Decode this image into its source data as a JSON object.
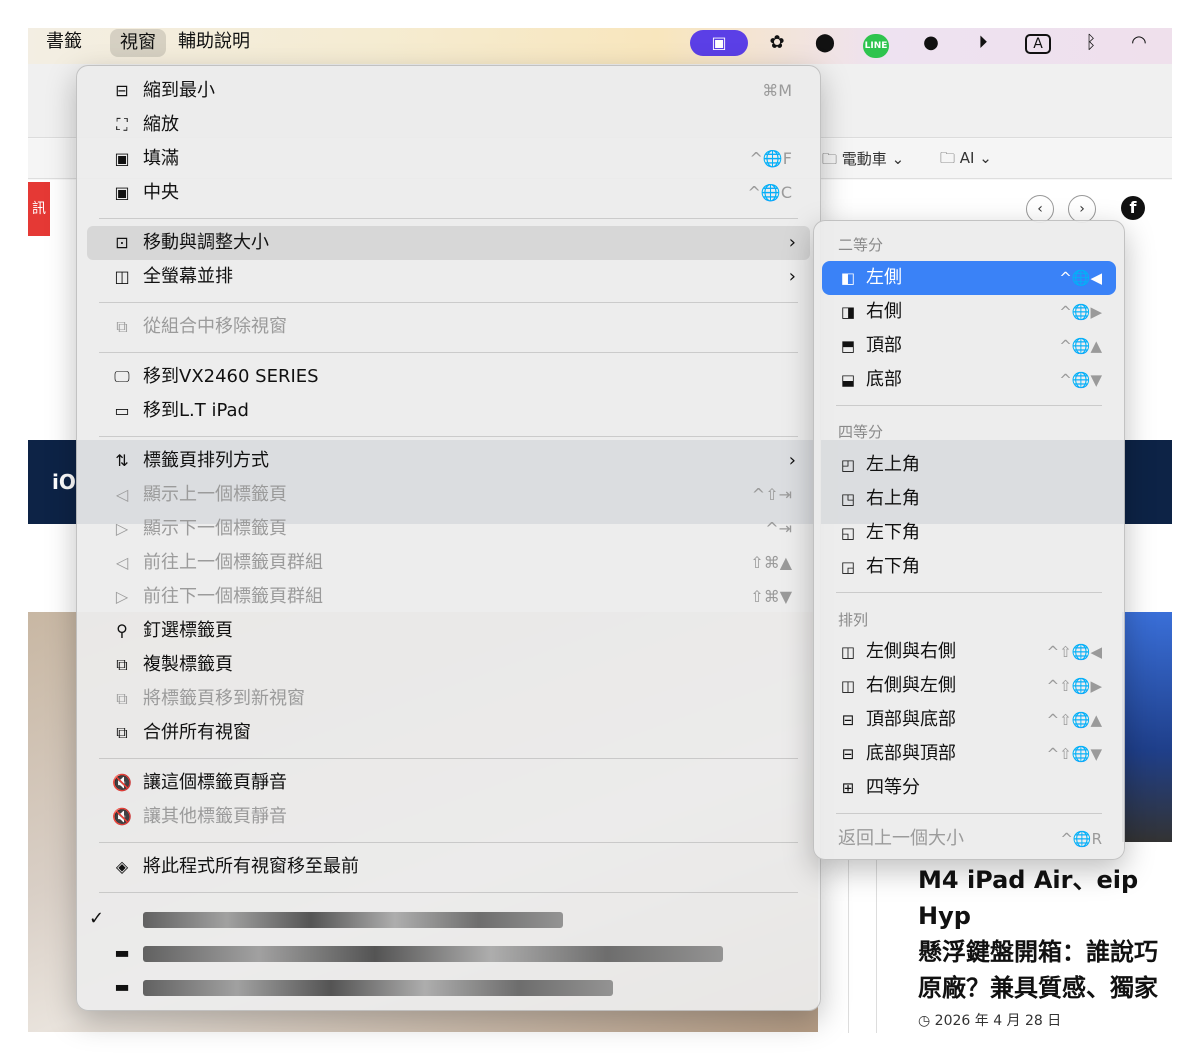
{
  "menubar": {
    "items": [
      "書籤",
      "視窗",
      "輔助說明"
    ],
    "icons": [
      "screen-share-icon",
      "chatgpt-icon",
      "ball-icon",
      "line-app-icon",
      "wechat-icon",
      "play-icon",
      "input-method-icon",
      "bluetooth-icon",
      "wifi-icon"
    ],
    "line_text": "LINE",
    "input_text": "A"
  },
  "browser": {
    "favorites": [
      "電動車",
      "AI"
    ],
    "site_badge": "訊",
    "nav_prev": "‹",
    "nav_next": "›",
    "nav_logo": "iO",
    "article": {
      "title": "M4 iPad Air、eip Hyp\n懸浮鍵盤開箱：誰說巧\n原廠？兼具質感、獨家\n能更好用",
      "date": "2026 年 4 月 28 日"
    }
  },
  "main_menu": {
    "items": [
      {
        "label": "縮到最小",
        "shortcut": "⌘M",
        "icon": "minimize-icon",
        "enabled": true
      },
      {
        "label": "縮放",
        "shortcut": "",
        "icon": "zoom-icon",
        "enabled": true
      },
      {
        "label": "填滿",
        "shortcut": "^🌐F",
        "icon": "fill-icon",
        "enabled": true
      },
      {
        "label": "中央",
        "shortcut": "^🌐C",
        "icon": "center-icon",
        "enabled": true
      },
      {
        "label": "移動與調整大小",
        "shortcut": "",
        "icon": "move-resize-icon",
        "enabled": true,
        "submenu": true,
        "highlighted": true
      },
      {
        "label": "全螢幕並排",
        "shortcut": "",
        "icon": "full-screen-tile-icon",
        "enabled": true,
        "submenu": true
      },
      {
        "label": "從組合中移除視窗",
        "shortcut": "",
        "icon": "remove-window-icon",
        "enabled": false
      },
      {
        "label": "移到VX2460 SERIES",
        "shortcut": "",
        "icon": "display-icon",
        "enabled": true
      },
      {
        "label": "移到L.T iPad",
        "shortcut": "",
        "icon": "ipad-icon",
        "enabled": true
      },
      {
        "label": "標籤頁排列方式",
        "shortcut": "",
        "icon": "sort-icon",
        "enabled": true,
        "submenu": true
      },
      {
        "label": "顯示上一個標籤頁",
        "shortcut": "^⇧⇥",
        "icon": "prev-tab-icon",
        "enabled": false
      },
      {
        "label": "顯示下一個標籤頁",
        "shortcut": "^⇥",
        "icon": "next-tab-icon",
        "enabled": false
      },
      {
        "label": "前往上一個標籤頁群組",
        "shortcut": "⇧⌘▲",
        "icon": "prev-group-icon",
        "enabled": false
      },
      {
        "label": "前往下一個標籤頁群組",
        "shortcut": "⇧⌘▼",
        "icon": "next-group-icon",
        "enabled": false
      },
      {
        "label": "釘選標籤頁",
        "shortcut": "",
        "icon": "pin-icon",
        "enabled": true
      },
      {
        "label": "複製標籤頁",
        "shortcut": "",
        "icon": "duplicate-icon",
        "enabled": true
      },
      {
        "label": "將標籤頁移到新視窗",
        "shortcut": "",
        "icon": "move-tab-icon",
        "enabled": false
      },
      {
        "label": "合併所有視窗",
        "shortcut": "",
        "icon": "merge-windows-icon",
        "enabled": true
      },
      {
        "label": "讓這個標籤頁靜音",
        "shortcut": "",
        "icon": "mute-icon",
        "enabled": true
      },
      {
        "label": "讓其他標籤頁靜音",
        "shortcut": "",
        "icon": "mute-others-icon",
        "enabled": false
      },
      {
        "label": "將此程式所有視窗移至最前",
        "shortcut": "",
        "icon": "bring-front-icon",
        "enabled": true
      }
    ],
    "check_mark": "✓"
  },
  "submenu": {
    "sections": [
      {
        "header": "二等分",
        "items": [
          {
            "label": "左側",
            "shortcut": "^🌐◀",
            "selected": true
          },
          {
            "label": "右側",
            "shortcut": "^🌐▶"
          },
          {
            "label": "頂部",
            "shortcut": "^🌐▲"
          },
          {
            "label": "底部",
            "shortcut": "^🌐▼"
          }
        ]
      },
      {
        "header": "四等分",
        "items": [
          {
            "label": "左上角",
            "shortcut": ""
          },
          {
            "label": "右上角",
            "shortcut": ""
          },
          {
            "label": "左下角",
            "shortcut": ""
          },
          {
            "label": "右下角",
            "shortcut": ""
          }
        ]
      },
      {
        "header": "排列",
        "items": [
          {
            "label": "左側與右側",
            "shortcut": "^⇧🌐◀"
          },
          {
            "label": "右側與左側",
            "shortcut": "^⇧🌐▶"
          },
          {
            "label": "頂部與底部",
            "shortcut": "^⇧🌐▲"
          },
          {
            "label": "底部與頂部",
            "shortcut": "^⇧🌐▼"
          },
          {
            "label": "四等分",
            "shortcut": ""
          }
        ]
      }
    ],
    "return_label": "返回上一個大小",
    "return_shortcut": "^🌐R"
  },
  "colors": {
    "accent": "#3a82f7",
    "screen_share": "#5b3fe6",
    "line_green": "#2ec44e"
  }
}
